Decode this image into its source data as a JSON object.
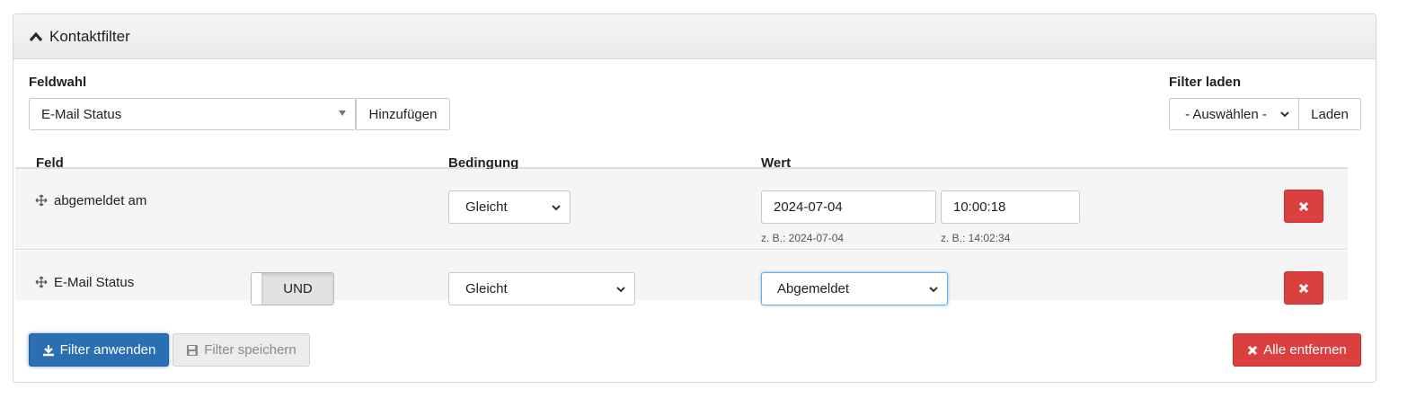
{
  "panel": {
    "title": "Kontaktfilter"
  },
  "field_select": {
    "label": "Feldwahl",
    "value": "E-Mail Status",
    "add_label": "Hinzufügen"
  },
  "filter_load": {
    "label": "Filter laden",
    "value": "- Auswählen -",
    "load_label": "Laden"
  },
  "table": {
    "headers": [
      "Feld",
      "Bedingung",
      "Wert"
    ],
    "rows": [
      {
        "field": "abgemeldet am",
        "condition": "Gleicht",
        "date_value": "2024-07-04",
        "time_value": "10:00:18",
        "date_hint": "z. B.: 2024-07-04",
        "time_hint": "z. B.: 14:02:34"
      },
      {
        "field": "E-Mail Status",
        "toggle": "UND",
        "condition": "Gleicht",
        "value": "Abgemeldet"
      }
    ]
  },
  "footer": {
    "apply_label": "Filter anwenden",
    "save_label": "Filter speichern",
    "remove_all_label": "Alle entfernen"
  },
  "colors": {
    "primary": "#2a6fb1",
    "danger": "#d9403e",
    "focus": "#66afe9"
  },
  "icons": [
    "chevron-up-icon",
    "sort-triangle-icon",
    "chevron-down-icon",
    "move-icon",
    "close-icon",
    "download-icon",
    "floppy-disk-icon"
  ]
}
